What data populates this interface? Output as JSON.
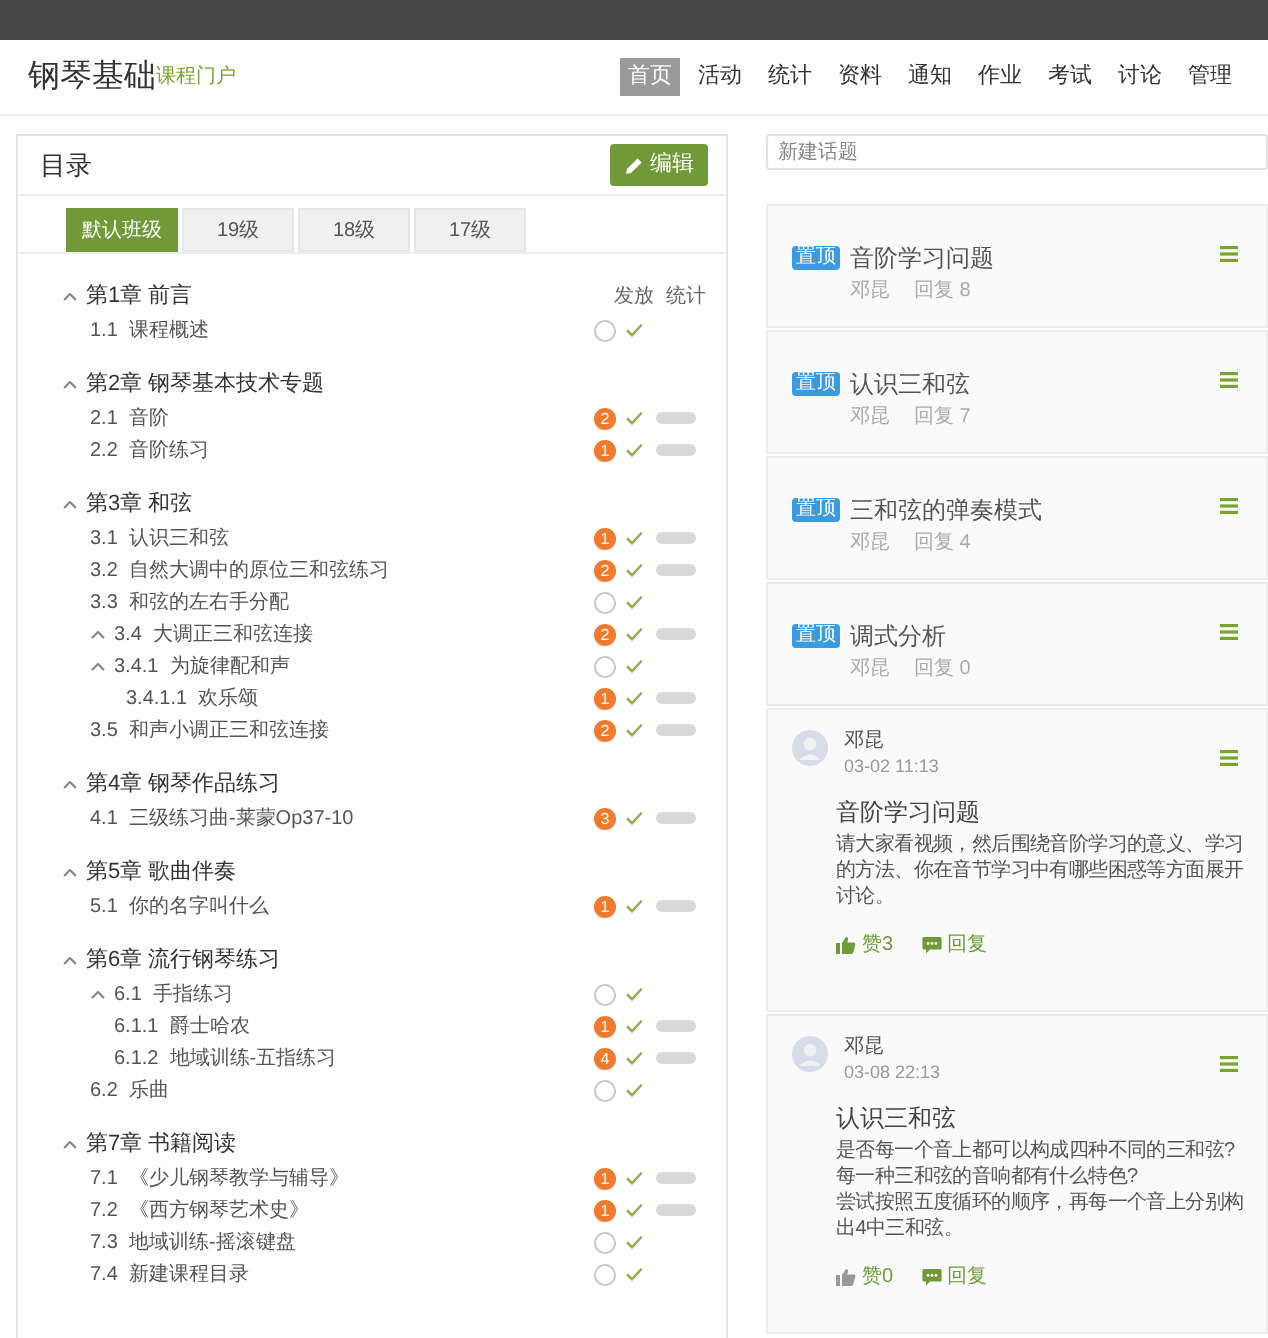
{
  "header": {
    "logo": "钢琴基础",
    "subtitle": "课程门户",
    "nav": [
      {
        "label": "首页",
        "selected": true
      },
      {
        "label": "活动",
        "selected": false
      },
      {
        "label": "统计",
        "selected": false
      },
      {
        "label": "资料",
        "selected": false
      },
      {
        "label": "通知",
        "selected": false
      },
      {
        "label": "作业",
        "selected": false
      },
      {
        "label": "考试",
        "selected": false
      },
      {
        "label": "讨论",
        "selected": false
      },
      {
        "label": "管理",
        "selected": false
      }
    ]
  },
  "catalog": {
    "title": "目录",
    "edit_button": "编辑",
    "tabs": [
      {
        "label": "默认班级",
        "selected": true
      },
      {
        "label": "19级",
        "selected": false
      },
      {
        "label": "18级",
        "selected": false
      },
      {
        "label": "17级",
        "selected": false
      }
    ],
    "columns": [
      "发放",
      "统计"
    ],
    "chapters": [
      {
        "title": "第1章 前言",
        "expanded": true,
        "items": [
          {
            "number": "1.1",
            "title": "课程概述",
            "released": true,
            "stats": false
          }
        ]
      },
      {
        "title": "第2章 钢琴基本技术专题",
        "expanded": true,
        "items": [
          {
            "number": "2.1",
            "title": "音阶",
            "badge": "2",
            "released": true,
            "stats": true
          },
          {
            "number": "2.2",
            "title": "音阶练习",
            "badge": "1",
            "released": true,
            "stats": true
          }
        ]
      },
      {
        "title": "第3章 和弦",
        "expanded": true,
        "items": [
          {
            "number": "3.1",
            "title": "认识三和弦",
            "badge": "1",
            "released": true,
            "stats": true
          },
          {
            "number": "3.2",
            "title": "自然大调中的原位三和弦练习",
            "badge": "2",
            "released": true,
            "stats": true
          },
          {
            "number": "3.3",
            "title": "和弦的左右手分配",
            "released": true,
            "stats": false
          },
          {
            "number": "3.4",
            "title": "大调正三和弦连接",
            "badge": "2",
            "released": true,
            "stats": true,
            "expanded": true,
            "children": [
              {
                "number": "3.4.1",
                "title": "为旋律配和声",
                "released": true,
                "stats": false,
                "expanded": true,
                "children": [
                  {
                    "number": "3.4.1.1",
                    "title": "欢乐颂",
                    "badge": "1",
                    "released": true,
                    "stats": true
                  }
                ]
              }
            ]
          },
          {
            "number": "3.5",
            "title": "和声小调正三和弦连接",
            "badge": "2",
            "released": true,
            "stats": true
          }
        ]
      },
      {
        "title": "第4章 钢琴作品练习",
        "expanded": true,
        "items": [
          {
            "number": "4.1",
            "title": "三级练习曲-莱蒙Op37-10",
            "badge": "3",
            "released": true,
            "stats": true
          }
        ]
      },
      {
        "title": "第5章 歌曲伴奏",
        "expanded": true,
        "items": [
          {
            "number": "5.1",
            "title": "你的名字叫什么",
            "badge": "1",
            "released": true,
            "stats": true
          }
        ]
      },
      {
        "title": "第6章 流行钢琴练习",
        "expanded": true,
        "items": [
          {
            "number": "6.1",
            "title": "手指练习",
            "released": true,
            "stats": false,
            "expanded": true,
            "children": [
              {
                "number": "6.1.1",
                "title": "爵士哈农",
                "badge": "1",
                "released": true,
                "stats": true
              },
              {
                "number": "6.1.2",
                "title": "地域训练-五指练习",
                "badge": "4",
                "released": true,
                "stats": true
              }
            ]
          },
          {
            "number": "6.2",
            "title": "乐曲",
            "released": true,
            "stats": false
          }
        ]
      },
      {
        "title": "第7章 书籍阅读",
        "expanded": true,
        "items": [
          {
            "number": "7.1",
            "title": "《少儿钢琴教学与辅导》",
            "badge": "1",
            "released": true,
            "stats": true
          },
          {
            "number": "7.2",
            "title": "《西方钢琴艺术史》",
            "badge": "1",
            "released": true,
            "stats": true
          },
          {
            "number": "7.3",
            "title": "地域训练-摇滚键盘",
            "released": true,
            "stats": false
          },
          {
            "number": "7.4",
            "title": "新建课程目录",
            "released": true,
            "stats": false
          }
        ]
      }
    ]
  },
  "topic_input": {
    "placeholder": "新建话题"
  },
  "pinned_topics": [
    {
      "tag": "置顶",
      "title": "音阶学习问题",
      "author": "邓昆",
      "replies": "回复 8"
    },
    {
      "tag": "置顶",
      "title": "认识三和弦",
      "author": "邓昆",
      "replies": "回复 7"
    },
    {
      "tag": "置顶",
      "title": "三和弦的弹奏模式",
      "author": "邓昆",
      "replies": "回复 4"
    },
    {
      "tag": "置顶",
      "title": "调式分析",
      "author": "邓昆",
      "replies": "回复 0"
    }
  ],
  "posts": [
    {
      "author": "邓昆",
      "time": "03-02 11:13",
      "title": "音阶学习问题",
      "body": "请大家看视频，然后围绕音阶学习的意义、学习的方法、你在音节学习中有哪些困惑等方面展开讨论。",
      "likes": "赞3",
      "liked": true,
      "reply": "回复"
    },
    {
      "author": "邓昆",
      "time": "03-08 22:13",
      "title": "认识三和弦",
      "body": "是否每一个音上都可以构成四种不同的三和弦?\n每一种三和弦的音响都有什么特色?\n尝试按照五度循环的顺序，再每一个音上分别构出4中三和弦。",
      "likes": "赞0",
      "liked": false,
      "reply": "回复"
    }
  ]
}
